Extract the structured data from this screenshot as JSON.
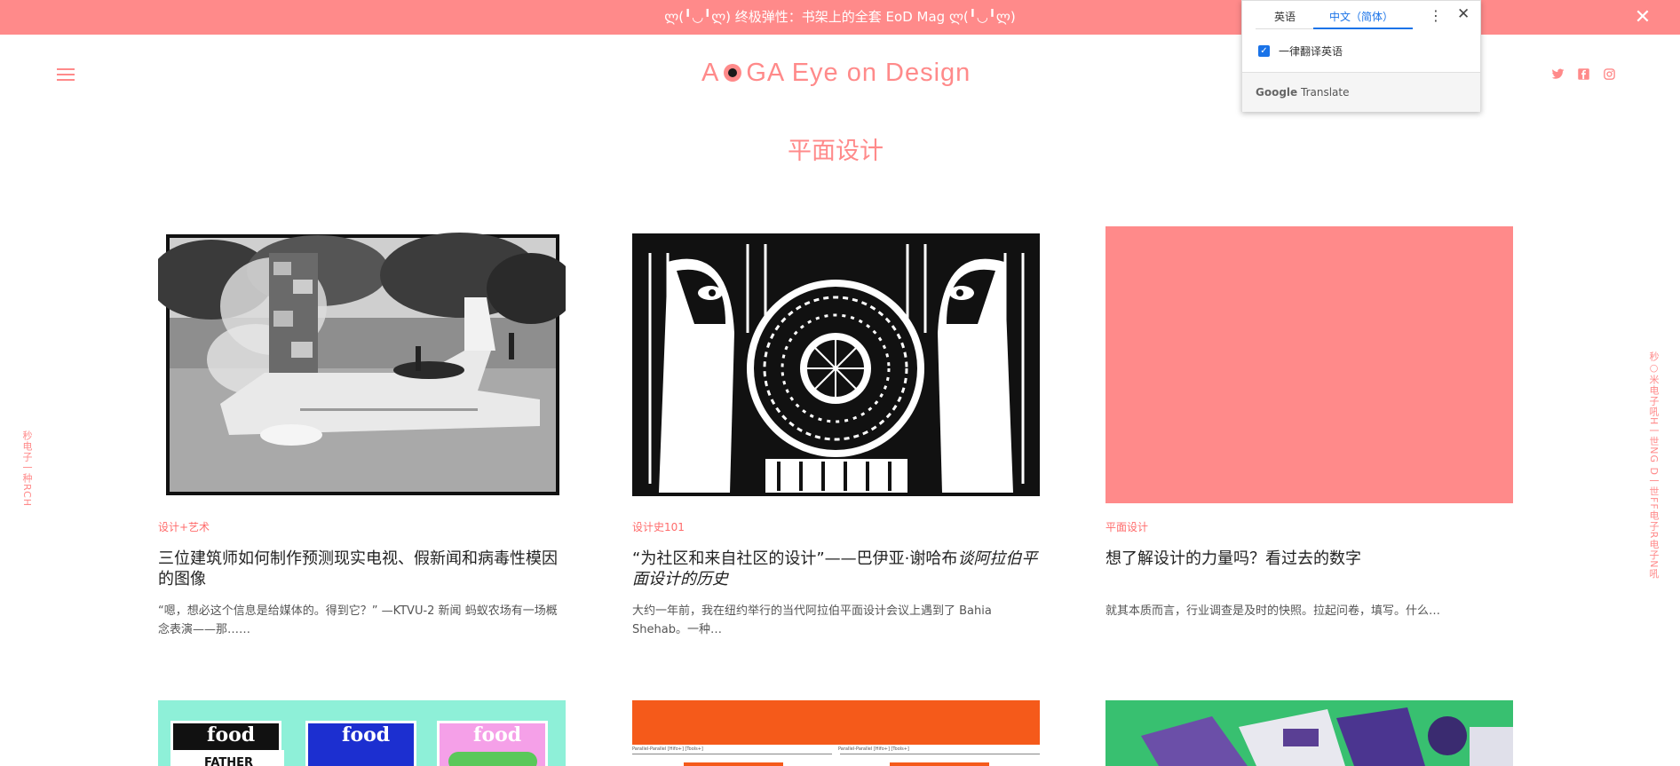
{
  "banner": {
    "text": "ლ(╹◡╹ლ) 终极弹性：书架上的全套 EoD Mag ლ(╹◡╹ლ)",
    "close_symbol": "✕"
  },
  "header": {
    "logo_left": "A",
    "logo_right": "GA Eye on Design"
  },
  "section": {
    "title": "平面设计"
  },
  "side_text": {
    "left": "秒电子一种RCH",
    "right": "秒○米电子吼H一世NG D一世FF电子R电子N吼"
  },
  "colors": {
    "accent": "#ff8a8a",
    "category": "#ff6b6b",
    "google_blue": "#1a73e8"
  },
  "articles": [
    {
      "category": "设计+艺术",
      "title": "三位建筑师如何制作预测现实电视、假新闻和病毒性模因的图像",
      "title_italic": "",
      "excerpt": "“嗯，想必这个信息是给媒体的。得到它？” —KTVU-2 新闻 蚂蚁农场有一场概念表演——那……"
    },
    {
      "category": "设计史101",
      "title": "“为社区和来自社区的设计”——巴伊亚·谢哈布",
      "title_italic": "谈阿拉伯平面设计的历史",
      "excerpt": "大约一年前，我在纽约举行的当代阿拉伯平面设计会议上遇到了 Bahia Shehab。一种…"
    },
    {
      "category": "平面设计",
      "title": "想了解设计的力量吗？看过去的数字",
      "title_italic": "",
      "excerpt": "就其本质而言，行业调查是及时的快照。拉起问卷，填写。什么…"
    }
  ],
  "second_row": {
    "food_label": "food",
    "father_text": "FATHER",
    "caption_a": "Parallel-Parallel [Hifo+] [Tools+]",
    "caption_b": "Parallel-Parallel [Hifo+] [Tools+]"
  },
  "translate_popup": {
    "tab_source": "英语",
    "tab_target": "中文（简体）",
    "more_symbol": "⋮",
    "close_symbol": "✕",
    "checkbox_label": "一律翻译英语",
    "brand_google": "Google",
    "brand_translate": "Translate"
  }
}
